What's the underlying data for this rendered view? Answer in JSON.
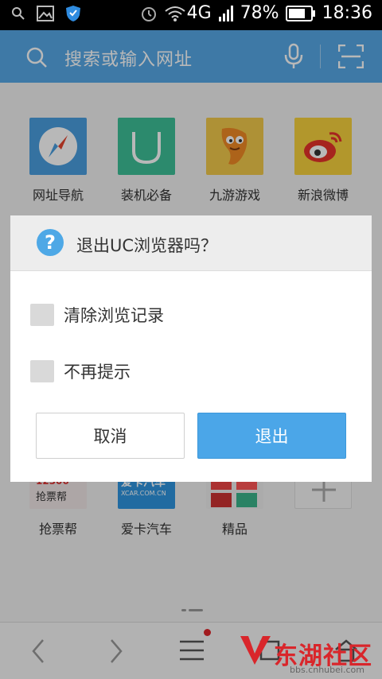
{
  "status_bar": {
    "network": "4G",
    "battery": "78%",
    "time": "18:36"
  },
  "search": {
    "placeholder": "搜索或输入网址"
  },
  "tiles_top": [
    {
      "label": "网址导航",
      "icon": "compass-icon"
    },
    {
      "label": "装机必备",
      "icon": "app-bag-icon"
    },
    {
      "label": "九游游戏",
      "icon": "game-mascot-icon"
    },
    {
      "label": "新浪微博",
      "icon": "weibo-icon"
    }
  ],
  "tiles_bottom": [
    {
      "label": "抢票帮",
      "icon": "ticket-icon",
      "icon_text": "12306",
      "icon_subtext": "抢票帮"
    },
    {
      "label": "爱卡汽车",
      "icon": "car-icon",
      "icon_text": "爱卡汽车",
      "icon_subtext": "XCAR.COM.CN"
    },
    {
      "label": "精品",
      "icon": "grid-apps-icon"
    },
    {
      "label": "",
      "icon": "add-icon"
    }
  ],
  "dialog": {
    "title": "退出UC浏览器吗？",
    "options": [
      {
        "label": "清除浏览记录",
        "checked": false
      },
      {
        "label": "不再提示",
        "checked": false
      }
    ],
    "cancel_label": "取消",
    "exit_label": "退出"
  },
  "watermark": {
    "text": "东湖社区",
    "url": "bbs.cnhubei.com"
  },
  "colors": {
    "accent": "#4ba6e8",
    "searchbar": "#56a8e6",
    "notification_dot": "#e0262b"
  }
}
